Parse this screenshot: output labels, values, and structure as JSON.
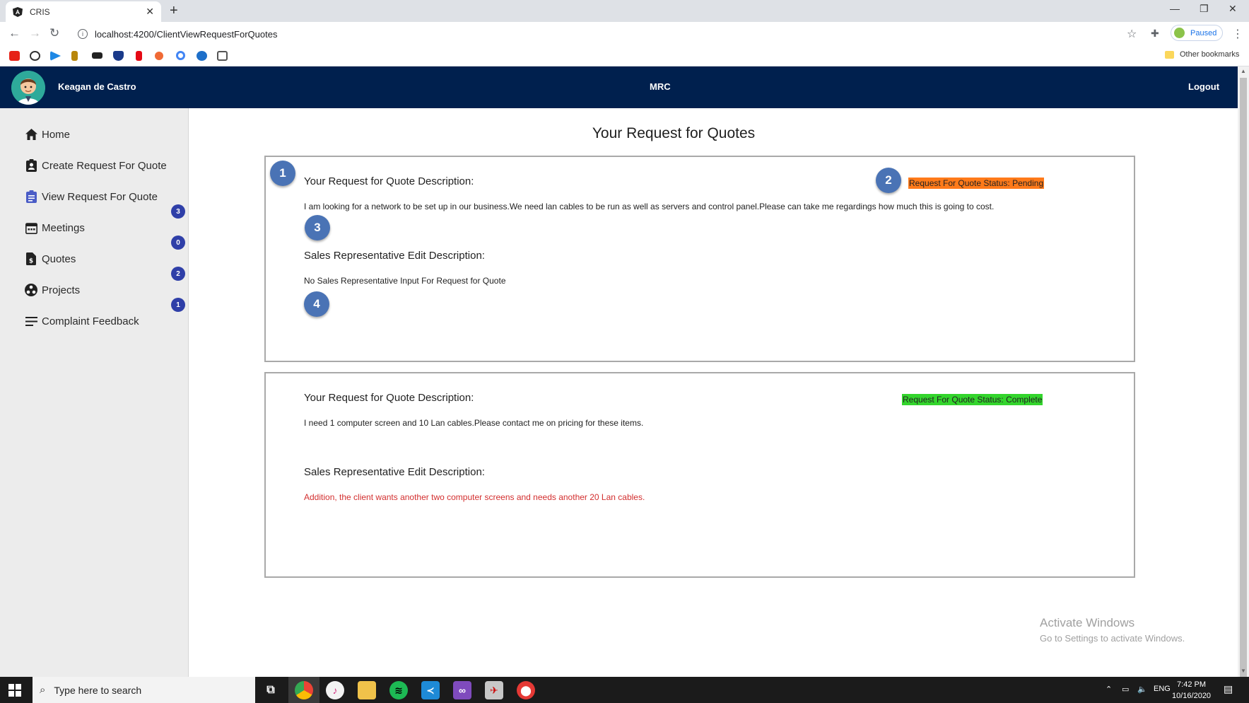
{
  "browser": {
    "tab_title": "CRIS",
    "url": "localhost:4200/ClientViewRequestForQuotes",
    "profile_status": "Paused",
    "other_bookmarks": "Other bookmarks"
  },
  "header": {
    "user_name": "Keagan de Castro",
    "brand": "MRC",
    "logout_label": "Logout"
  },
  "sidebar": {
    "items": [
      {
        "label": "Home",
        "icon": "home-icon"
      },
      {
        "label": "Create Request For Quote",
        "icon": "clipboard-user-icon"
      },
      {
        "label": "View Request For Quote",
        "icon": "clipboard-list-icon",
        "badge": "3"
      },
      {
        "label": "Meetings",
        "icon": "calendar-icon",
        "badge": "0"
      },
      {
        "label": "Quotes",
        "icon": "dollar-file-icon",
        "badge": "2"
      },
      {
        "label": "Projects",
        "icon": "projects-icon",
        "badge": "1"
      },
      {
        "label": "Complaint Feedback",
        "icon": "list-lines-icon"
      }
    ]
  },
  "main": {
    "title": "Your Request for Quotes",
    "requests": [
      {
        "heading": "Your Request for Quote Description:",
        "description": "I am looking for a network to be set up in our business.We need lan cables to be run as well as servers and control panel.Please can take me regardings how much this is going to cost.",
        "status": "Request For Quote Status: Pending",
        "status_color": "#ff7a1a",
        "rep_heading": "Sales Representative Edit Description:",
        "rep_description": "No Sales Representative Input For Request for Quote"
      },
      {
        "heading": "Your Request for Quote Description:",
        "description": "I need 1 computer screen and 10 Lan cables.Please contact me on pricing for these items.",
        "status": "Request For Quote Status: Complete",
        "status_color": "#33d52c",
        "rep_heading": "Sales Representative Edit Description:",
        "rep_description": "Addition, the client wants another two computer screens and needs another 20 Lan cables.",
        "rep_description_color": "#d32f2f"
      }
    ],
    "step_markers": [
      "1",
      "2",
      "3",
      "4"
    ]
  },
  "watermark": {
    "line1": "Activate Windows",
    "line2": "Go to Settings to activate Windows."
  },
  "taskbar": {
    "search_placeholder": "Type here to search",
    "language": "ENG",
    "time": "7:42 PM",
    "date": "10/16/2020"
  },
  "colors": {
    "appbar": "#00204e",
    "sidebar": "#ececec",
    "badge": "#2f3fa8",
    "step_marker": "#4a73b5"
  }
}
